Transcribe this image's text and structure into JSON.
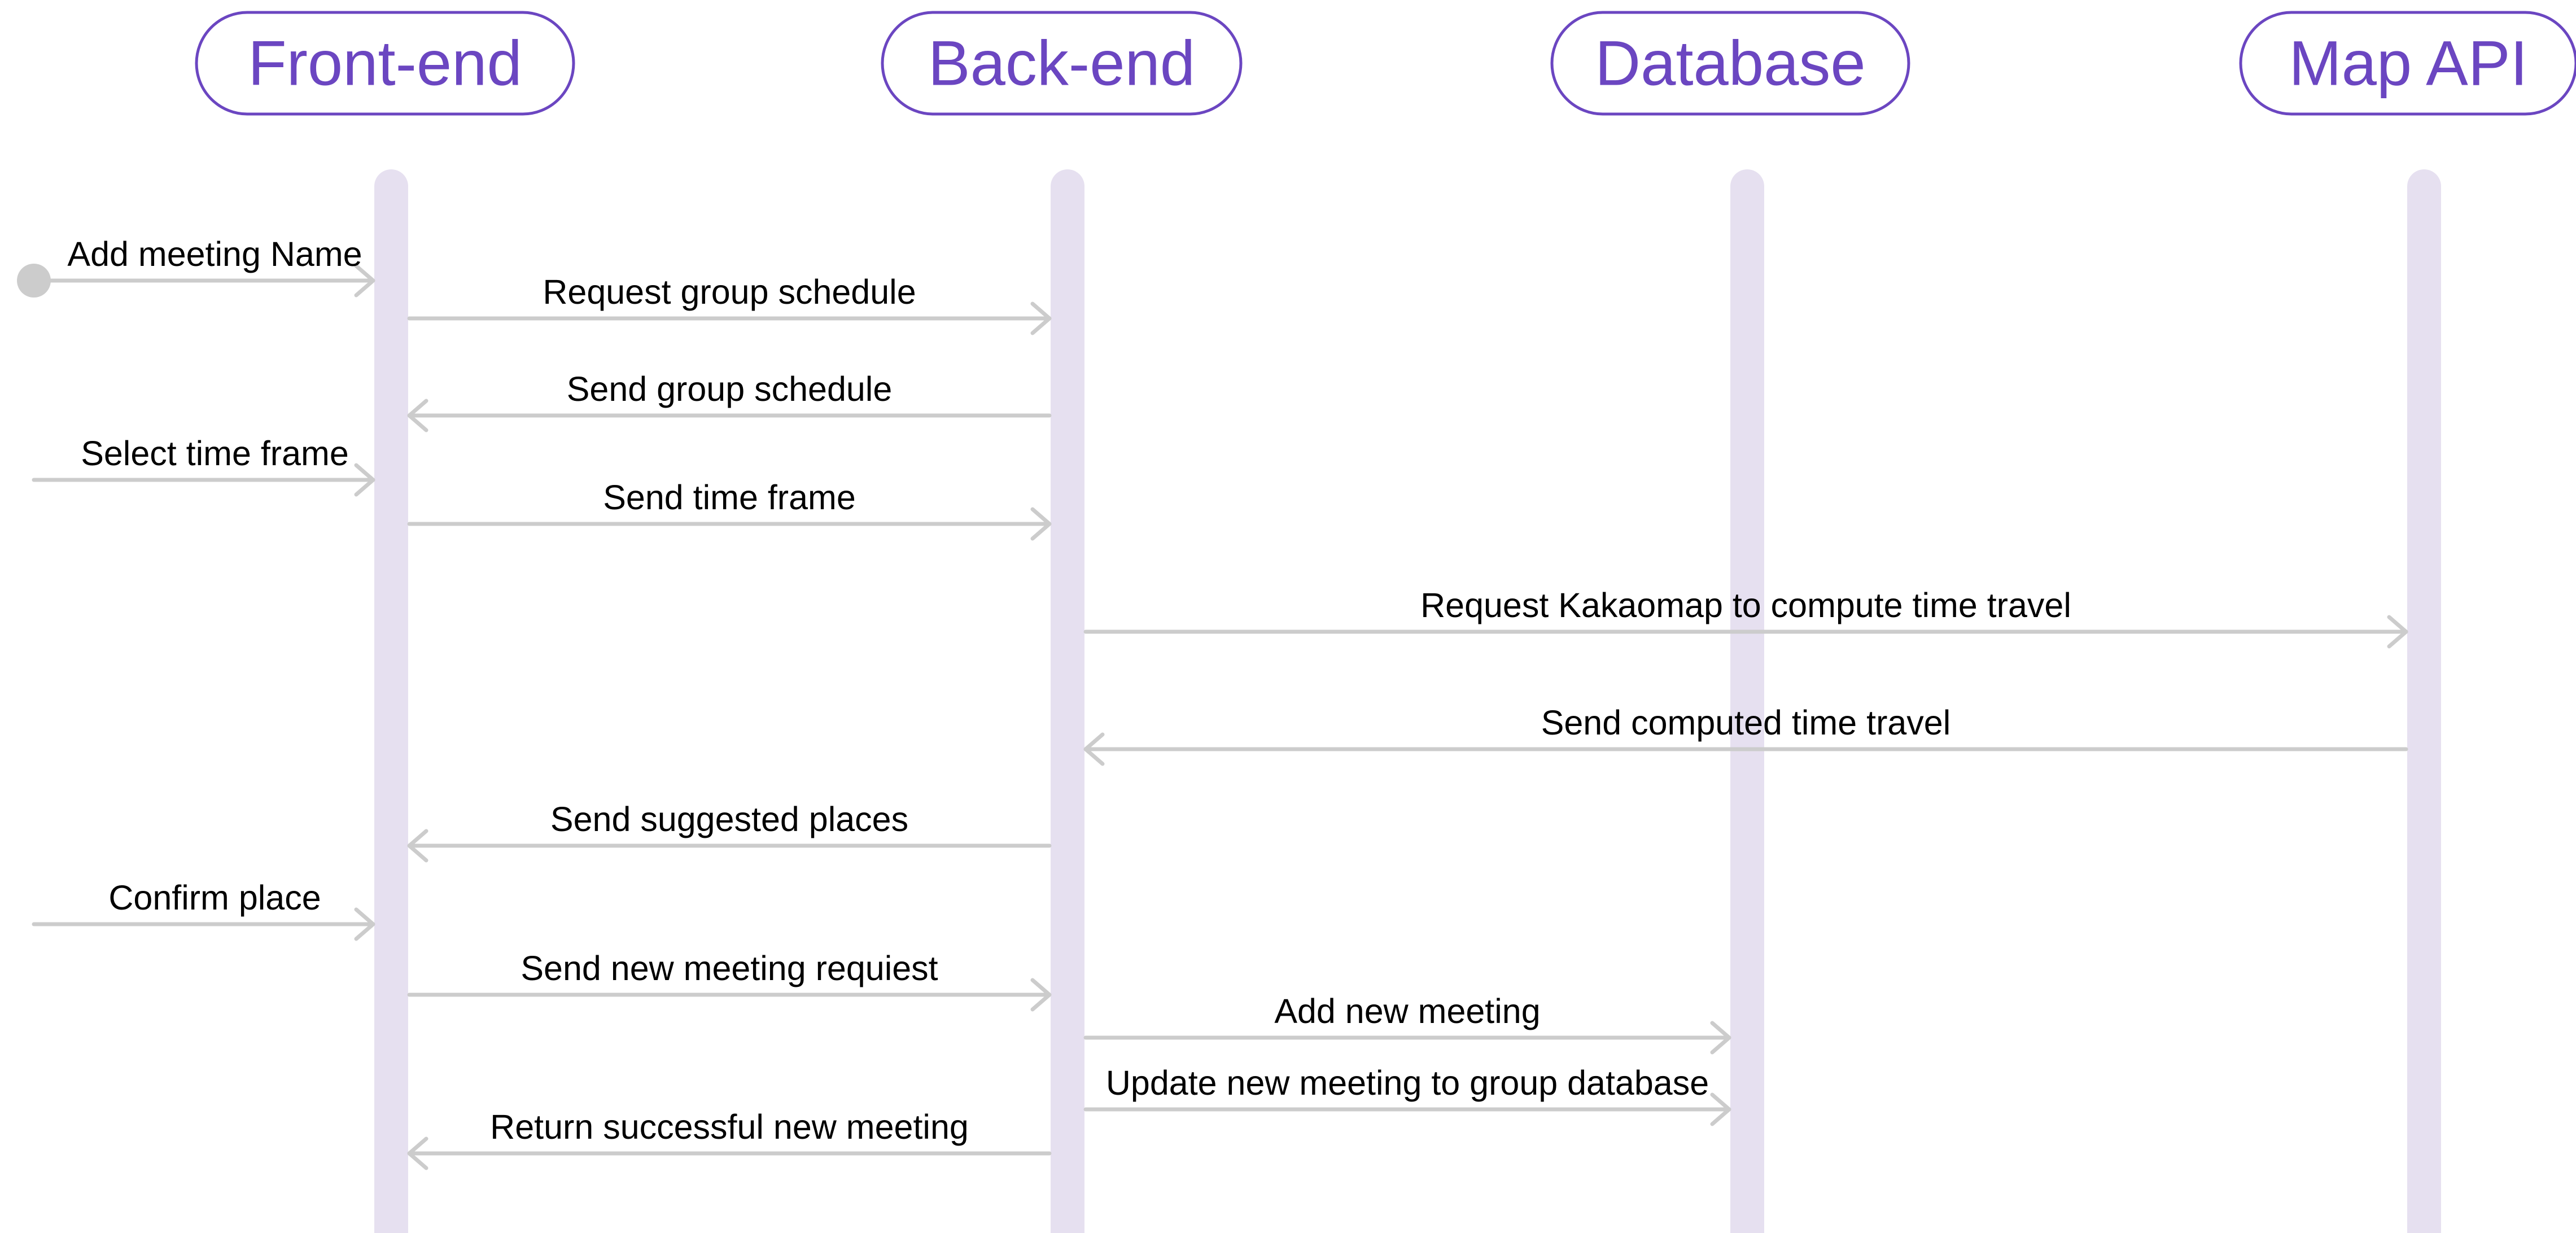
{
  "participants": [
    {
      "id": "frontend",
      "label": "Front-end"
    },
    {
      "id": "backend",
      "label": "Back-end"
    },
    {
      "id": "database",
      "label": "Database"
    },
    {
      "id": "mapapi",
      "label": "Map API"
    }
  ],
  "messages": [
    {
      "from": "start",
      "to": "frontend",
      "label": "Add meeting Name",
      "start_marker": true
    },
    {
      "from": "frontend",
      "to": "backend",
      "label": "Request group schedule"
    },
    {
      "from": "backend",
      "to": "frontend",
      "label": "Send group schedule"
    },
    {
      "from": "start",
      "to": "frontend",
      "label": "Select time frame"
    },
    {
      "from": "frontend",
      "to": "backend",
      "label": "Send time frame"
    },
    {
      "from": "backend",
      "to": "mapapi",
      "label": "Request Kakaomap to compute time travel"
    },
    {
      "from": "mapapi",
      "to": "backend",
      "label": "Send computed time travel"
    },
    {
      "from": "backend",
      "to": "frontend",
      "label": "Send suggested places"
    },
    {
      "from": "start",
      "to": "frontend",
      "label": "Confirm place"
    },
    {
      "from": "frontend",
      "to": "backend",
      "label": "Send new meeting requiest"
    },
    {
      "from": "backend",
      "to": "database",
      "label": "Add new meeting"
    },
    {
      "from": "backend",
      "to": "database",
      "label": "Update new meeting to group database"
    },
    {
      "from": "backend",
      "to": "frontend",
      "label": "Return successful new meeting"
    }
  ],
  "colors": {
    "participant_accent": "#6b46c1",
    "lifeline": "#e6e0f0",
    "arrow": "#cccccc",
    "label_text": "#000000"
  }
}
